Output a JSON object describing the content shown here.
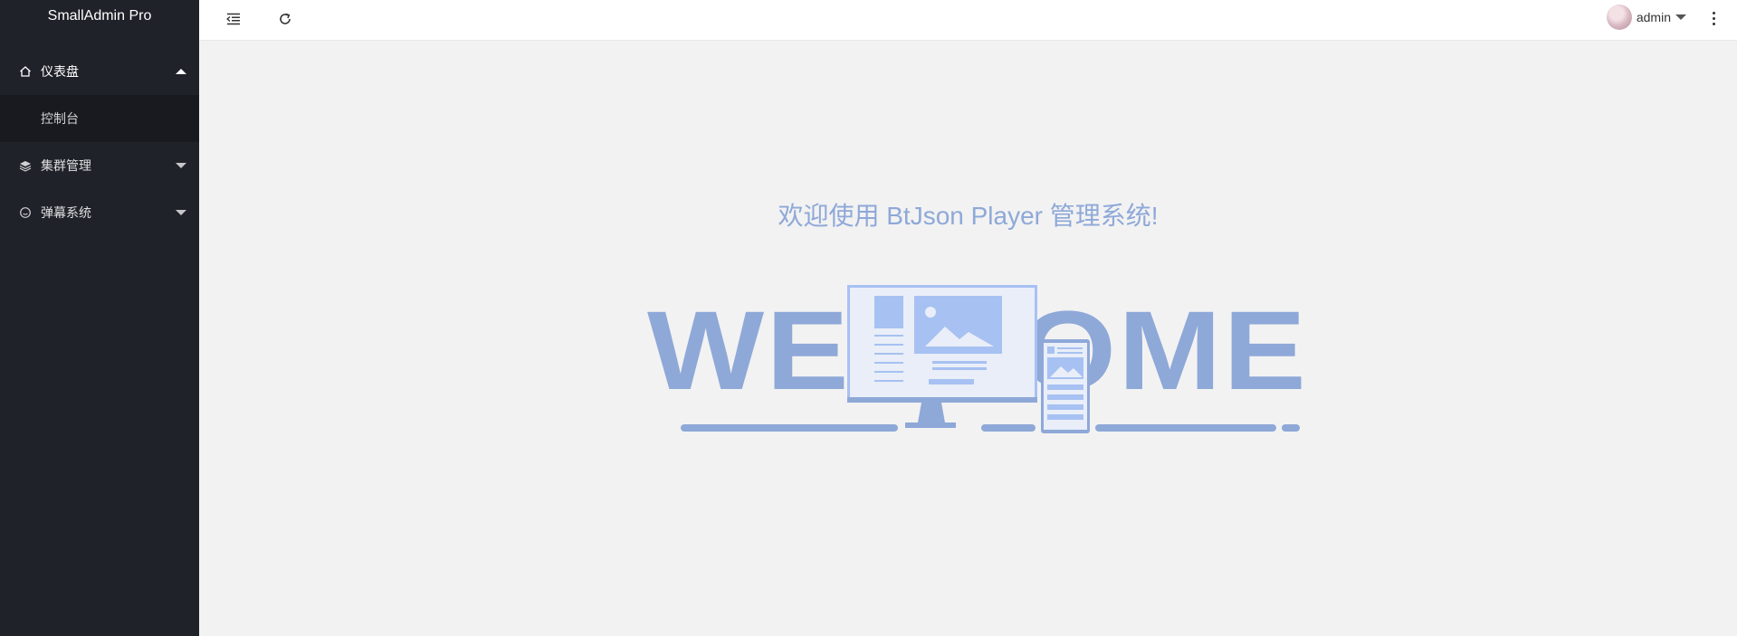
{
  "sidebar": {
    "brand": "SmallAdmin Pro",
    "groups": [
      {
        "label": "仪表盘",
        "icon": "home-icon",
        "expanded": true,
        "children": [
          {
            "label": "控制台"
          }
        ]
      },
      {
        "label": "集群管理",
        "icon": "layers-icon",
        "expanded": false
      },
      {
        "label": "弹幕系统",
        "icon": "smile-icon",
        "expanded": false
      }
    ]
  },
  "header": {
    "toggle_icon": "menu-indent-icon",
    "refresh_icon": "refresh-icon",
    "user_name": "admin",
    "more_icon": "more-vertical-icon"
  },
  "main": {
    "welcome_title": "欢迎使用 BtJson Player 管理系统!",
    "illustration_text": "WELCOME"
  },
  "colors": {
    "sidebar_bg": "#20222a",
    "submenu_bg": "#181a20",
    "accent": "#8ea8d8",
    "page_bg": "#f2f2f2"
  }
}
